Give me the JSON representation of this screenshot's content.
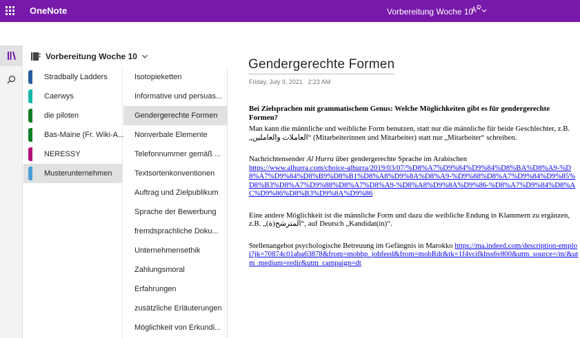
{
  "app": {
    "name": "OneNote",
    "document_title": "Vorbereitung Woche 10",
    "brand_color": "#7719aa"
  },
  "rail": {
    "items": [
      {
        "icon": "notebooks-icon",
        "active": true
      },
      {
        "icon": "search-icon",
        "active": false
      }
    ]
  },
  "notebook": {
    "name": "Vorbereitung Woche 10"
  },
  "sections": [
    {
      "label": "Stradbally Ladders",
      "color": "#2a5d9e"
    },
    {
      "label": "Caerwys",
      "color": "#16b7a8"
    },
    {
      "label": "die piloten",
      "color": "#0f7d26"
    },
    {
      "label": "Bas-Maine (Fr. Wiki-A...",
      "color": "#0f7d26"
    },
    {
      "label": "NERESSY",
      "color": "#b4127a"
    },
    {
      "label": "Musterunternehmen",
      "color": "#4a9fd6",
      "active": true
    }
  ],
  "pages": [
    {
      "label": "Isotopieketten"
    },
    {
      "label": "Informative und persuas..."
    },
    {
      "label": "Gendergerechte Formen",
      "active": true
    },
    {
      "label": "Nonverbale Elemente"
    },
    {
      "label": "Telefonnummer gemäß ..."
    },
    {
      "label": "Textsortenkonventionen"
    },
    {
      "label": "Auftrag und Zielpublikum"
    },
    {
      "label": "Sprache der Bewerbung"
    },
    {
      "label": "fremdsprachliche Doku..."
    },
    {
      "label": "Unternehmensethik"
    },
    {
      "label": "Zahlungsmoral"
    },
    {
      "label": "Erfahrungen"
    },
    {
      "label": "zusätzliche Erläuterungen"
    },
    {
      "label": "Möglichkeit von Erkundi..."
    }
  ],
  "page": {
    "title": "Gendergerechte Formen",
    "date": "Friday, July 9, 2021",
    "time": "2:23 AM",
    "heading": "Bei Zielsprachen mit grammatischem Genus: Welche Möglichkeiten gibt es für gendergerechte Formen?",
    "p1": "Man kann die männliche und weibliche Form benutzen, statt nur die männliche für beide Geschlechter, z.B. „العاملات والعاملين“ (Mitarbeiterinnen und Mitarbeiter) statt nur „Mitarbeiter“ schreiben.",
    "p2_prefix": "Nachrichtensender ",
    "p2_italic": "Al Hurra",
    "p2_suffix": " über gendergerechte Sprache im Arabischen",
    "p2_link": "https://www.alhurra.com/choice-alhurra/2019/03/07/%D8%A7%D9%84%D9%84%D8%BA%D8%A9-%D8%A7%D9%84%D8%B9%D8%B1%D8%A8%D9%8A%D8%A9-%D9%88%D8%A7%D9%84%D9%85%D8%B3%D8%A7%D9%88%D8%A7%D8%A9-%D8%A8%D9%8A%D9%86-%D8%A7%D9%84%D8%AC%D9%86%D8%B3%D9%8A%D9%86",
    "p3": "Eine andere Möglichkeit ist die männliche Form und dazu die weibliche Endung in Klammern zu ergänzen, z.B. „المترشح(ة)“, auf Deutsch „Kandidat(in)“.",
    "p4_prefix": "Stellenangebot psychologische Betreuung im Gefängnis in Marokko ",
    "p4_link": "https://ma.indeed.com/description-emploi?jk=70874c01aba63878&from=mobhp_jobfeed&from=mobRdr&tk=1f4vcifkbss6v800&utm_source=/m/&utm_medium=redir&utm_campaign=dt"
  }
}
